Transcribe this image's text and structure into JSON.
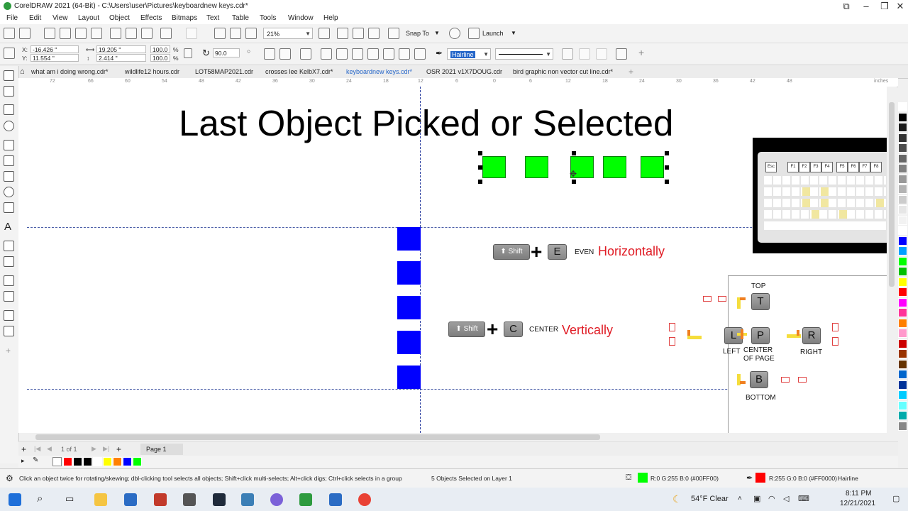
{
  "window": {
    "title": "CorelDRAW 2021 (64-Bit) - C:\\Users\\user\\Pictures\\keyboardnew keys.cdr*"
  },
  "menu": [
    "File",
    "Edit",
    "View",
    "Layout",
    "Object",
    "Effects",
    "Bitmaps",
    "Text",
    "Table",
    "Tools",
    "Window",
    "Help"
  ],
  "toolbar": {
    "zoom_value": "21%",
    "snap_to_label": "Snap To",
    "launch_label": "Launch"
  },
  "properties": {
    "x_label": "X:",
    "x_value": "-16.426 \"",
    "y_label": "Y:",
    "y_value": "11.554 \"",
    "width_value": "19.205 \"",
    "height_value": "2.414 \"",
    "scale_w": "100.0",
    "scale_h": "100.0",
    "percent": "%",
    "rotation": "90.0",
    "outline_width": "Hairline"
  },
  "document_tabs": [
    "what am i doing wrong.cdr*",
    "wildlife12 hours.cdr",
    "LOT58MAP2021.cdr",
    "crosses lee KelbX7.cdr*",
    "keyboardnew keys.cdr*",
    "OSR 2021 v1X7DOUG.cdr",
    "bird graphic non vector cut line.cdr*"
  ],
  "ruler": {
    "units": "inches",
    "ticks": [
      "72",
      "66",
      "60",
      "54",
      "48",
      "42",
      "36",
      "30",
      "24",
      "18",
      "12",
      "6",
      "0",
      "6",
      "12",
      "18",
      "24",
      "30",
      "36",
      "42",
      "48"
    ]
  },
  "canvas": {
    "heading": "Last Object Picked or Selected",
    "shift_key_label": "Shift",
    "row1_plus": "+",
    "row1_key": "E",
    "row1_small": "EVEN",
    "row1_word": "Horizontally",
    "row2_plus": "+",
    "row2_key": "C",
    "row2_small": "CENTER",
    "row2_word": "Vertically",
    "align_panel": {
      "top_label": "TOP",
      "top_key": "T",
      "left_key": "L",
      "left_label": "LEFT",
      "center_key": "P",
      "center_label_1": "CENTER",
      "center_label_2": "OF PAGE",
      "right_key": "R",
      "right_label": "RIGHT",
      "bottom_key": "B",
      "bottom_label": "BOTTOM"
    },
    "green_squares_count": 5,
    "blue_squares_count": 5,
    "keyboard_keys": [
      "Esc",
      "F1",
      "F2",
      "F3",
      "F4",
      "F5",
      "F6",
      "F7",
      "F8"
    ]
  },
  "pagebar": {
    "page_of": "1 of 1",
    "page_tab": "Page 1"
  },
  "status": {
    "hint": "Click an object twice for rotating/skewing; dbl-clicking tool selects all objects; Shift+click multi-selects; Alt+click digs; Ctrl+click selects in a group",
    "selection": "5 Objects Selected on Layer 1",
    "fill_text": "R:0 G:255 B:0 (#00FF00)",
    "outline_text": "R:255 G:0 B:0 (#FF0000)",
    "outline_width": "Hairline"
  },
  "taskbar": {
    "weather": "54°F  Clear",
    "time": "8:11 PM",
    "date": "12/21/2021"
  },
  "colors": {
    "fill": "#00FF00",
    "outline": "#FF0000",
    "blue": "#0000FF",
    "heading_red": "#E01B24"
  },
  "right_palette": [
    "#ffffff",
    "#000000",
    "#1a1a1a",
    "#333333",
    "#4d4d4d",
    "#666666",
    "#808080",
    "#999999",
    "#b3b3b3",
    "#cccccc",
    "#e6e6e6",
    "#f2f2f2",
    "#ffffff",
    "#0000ff",
    "#00a0ff",
    "#00ff00",
    "#00c000",
    "#ffff00",
    "#ff0000",
    "#ff00ff",
    "#ff3399",
    "#ff8000",
    "#ff99cc",
    "#cc0000",
    "#993300",
    "#663300",
    "#0066cc",
    "#003399",
    "#00ccff",
    "#66ffff",
    "#00aaaa",
    "#888888"
  ],
  "doc_palette": [
    "#ff0000",
    "#000000",
    "#000000",
    "#ffffff",
    "#ffff00",
    "#ff8000",
    "#0000ff",
    "#00ff00"
  ]
}
